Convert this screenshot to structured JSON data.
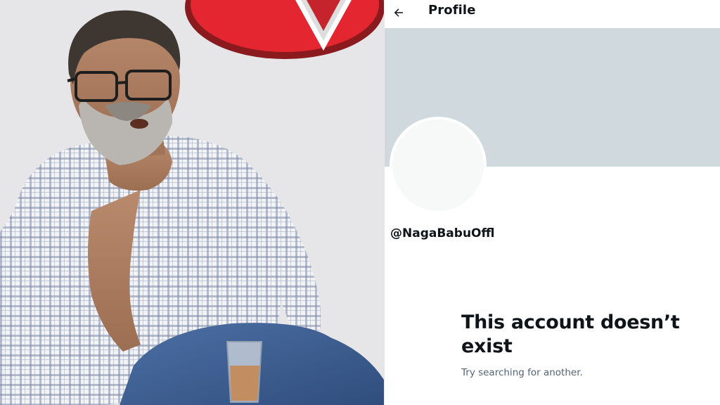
{
  "profile_panel": {
    "header": {
      "back_icon": "arrow-left-icon",
      "title": "Profile"
    },
    "handle": "@NagaBabuOffl",
    "empty_state": {
      "title": "This account doesn’t exist",
      "subtitle": "Try searching for another."
    }
  },
  "colors": {
    "banner": "#cfd9de",
    "avatar": "#f7f9f9",
    "text_primary": "#0f1419",
    "text_secondary": "#536471",
    "logo_red": "#e3262f"
  }
}
